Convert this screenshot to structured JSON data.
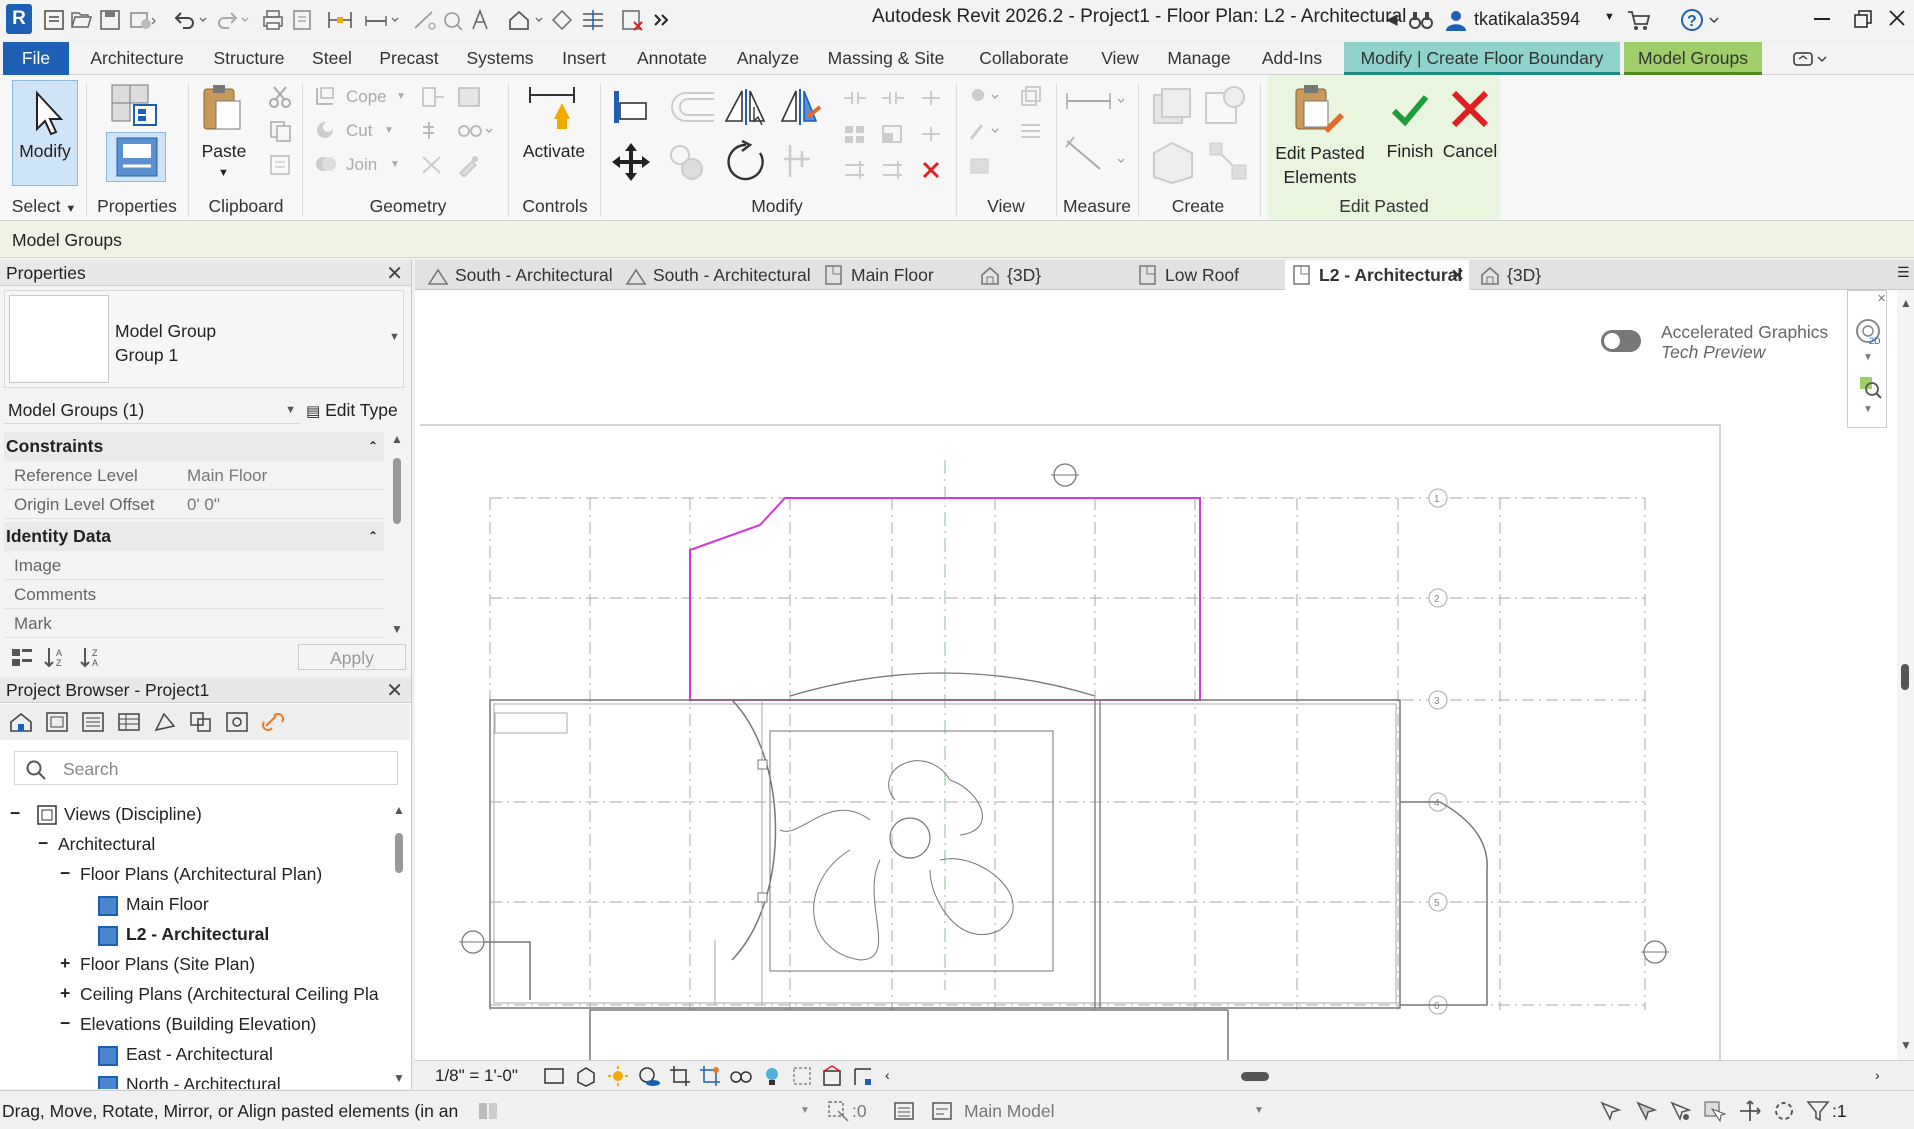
{
  "app": {
    "title": "Autodesk Revit 2026.2 - Project1 - Floor Plan: L2 - Architectural",
    "user": "tkatikala3594",
    "logo_letter": "R"
  },
  "ribbon_tabs": [
    "File",
    "Architecture",
    "Structure",
    "Steel",
    "Precast",
    "Systems",
    "Insert",
    "Annotate",
    "Analyze",
    "Massing & Site",
    "Collaborate",
    "View",
    "Manage",
    "Add-Ins",
    "Modify | Create Floor Boundary",
    "Model Groups"
  ],
  "ribbon": {
    "select": {
      "modify": "Modify",
      "panel": "Select"
    },
    "properties": {
      "label": "Properties"
    },
    "clipboard": {
      "paste": "Paste",
      "panel": "Clipboard"
    },
    "geometry": {
      "cope": "Cope",
      "cut": "Cut",
      "join": "Join",
      "panel": "Geometry"
    },
    "controls": {
      "activate": "Activate",
      "panel": "Controls"
    },
    "modify_panel": "Modify",
    "view_panel": "View",
    "measure_panel": "Measure",
    "create_panel": "Create",
    "edit_pasted": {
      "btn_line1": "Edit Pasted",
      "btn_line2": "Elements",
      "finish": "Finish",
      "cancel": "Cancel",
      "panel": "Edit Pasted"
    }
  },
  "context_bar": "Model Groups",
  "properties": {
    "header": "Properties",
    "type_line1": "Model Group",
    "type_line2": "Group 1",
    "selector": "Model Groups (1)",
    "edit_type": "Edit Type",
    "sections": [
      {
        "name": "Constraints",
        "rows": [
          {
            "k": "Reference Level",
            "v": "Main Floor"
          },
          {
            "k": "Origin Level Offset",
            "v": "0'  0\""
          }
        ]
      },
      {
        "name": "Identity Data",
        "rows": [
          {
            "k": "Image",
            "v": ""
          },
          {
            "k": "Comments",
            "v": ""
          },
          {
            "k": "Mark",
            "v": ""
          }
        ]
      }
    ],
    "apply": "Apply"
  },
  "browser": {
    "header": "Project Browser - Project1",
    "search_placeholder": "Search",
    "items": [
      {
        "label": "Views (Discipline)",
        "level": 0,
        "sign": "−"
      },
      {
        "label": "Architectural",
        "level": 1,
        "sign": "−"
      },
      {
        "label": "Floor Plans (Architectural Plan)",
        "level": 2,
        "sign": "−"
      },
      {
        "label": "Main Floor",
        "level": 3,
        "sign": ""
      },
      {
        "label": "L2 - Architectural",
        "level": 3,
        "sign": "",
        "bold": true
      },
      {
        "label": "Floor Plans (Site Plan)",
        "level": 2,
        "sign": "+"
      },
      {
        "label": "Ceiling Plans (Architectural Ceiling Pla",
        "level": 2,
        "sign": "+"
      },
      {
        "label": "Elevations (Building Elevation)",
        "level": 2,
        "sign": "−"
      },
      {
        "label": "East - Architectural",
        "level": 3,
        "sign": ""
      },
      {
        "label": "North - Architectural",
        "level": 3,
        "sign": ""
      }
    ]
  },
  "view_tabs": [
    {
      "label": "South - Architectural",
      "icon": "elevation"
    },
    {
      "label": "South - Architectural",
      "icon": "elevation"
    },
    {
      "label": "Main Floor",
      "icon": "plan"
    },
    {
      "label": "{3D}",
      "icon": "3d"
    },
    {
      "label": "Low Roof",
      "icon": "plan"
    },
    {
      "label": "L2 - Architectural",
      "icon": "plan",
      "active": true
    },
    {
      "label": "{3D}",
      "icon": "3d"
    }
  ],
  "canvas": {
    "accel_line1": "Accelerated Graphics",
    "accel_line2": "Tech Preview",
    "grid_labels": [
      "1",
      "2",
      "3",
      "4",
      "5",
      "6"
    ]
  },
  "view_control": {
    "scale": "1/8\" = 1'-0\""
  },
  "status": {
    "message": "Drag, Move, Rotate, Mirror, or Align pasted elements (in an",
    "count": ":0",
    "model": "Main Model",
    "filter": ":1"
  },
  "colors": {
    "accent_blue": "#1c5fb4",
    "modify_tab": "#8fd3cc",
    "groups_tab": "#9ecf6a",
    "finish_green": "#1e9e3a",
    "cancel_red": "#e02020",
    "boundary_magenta": "#d23ad8"
  }
}
